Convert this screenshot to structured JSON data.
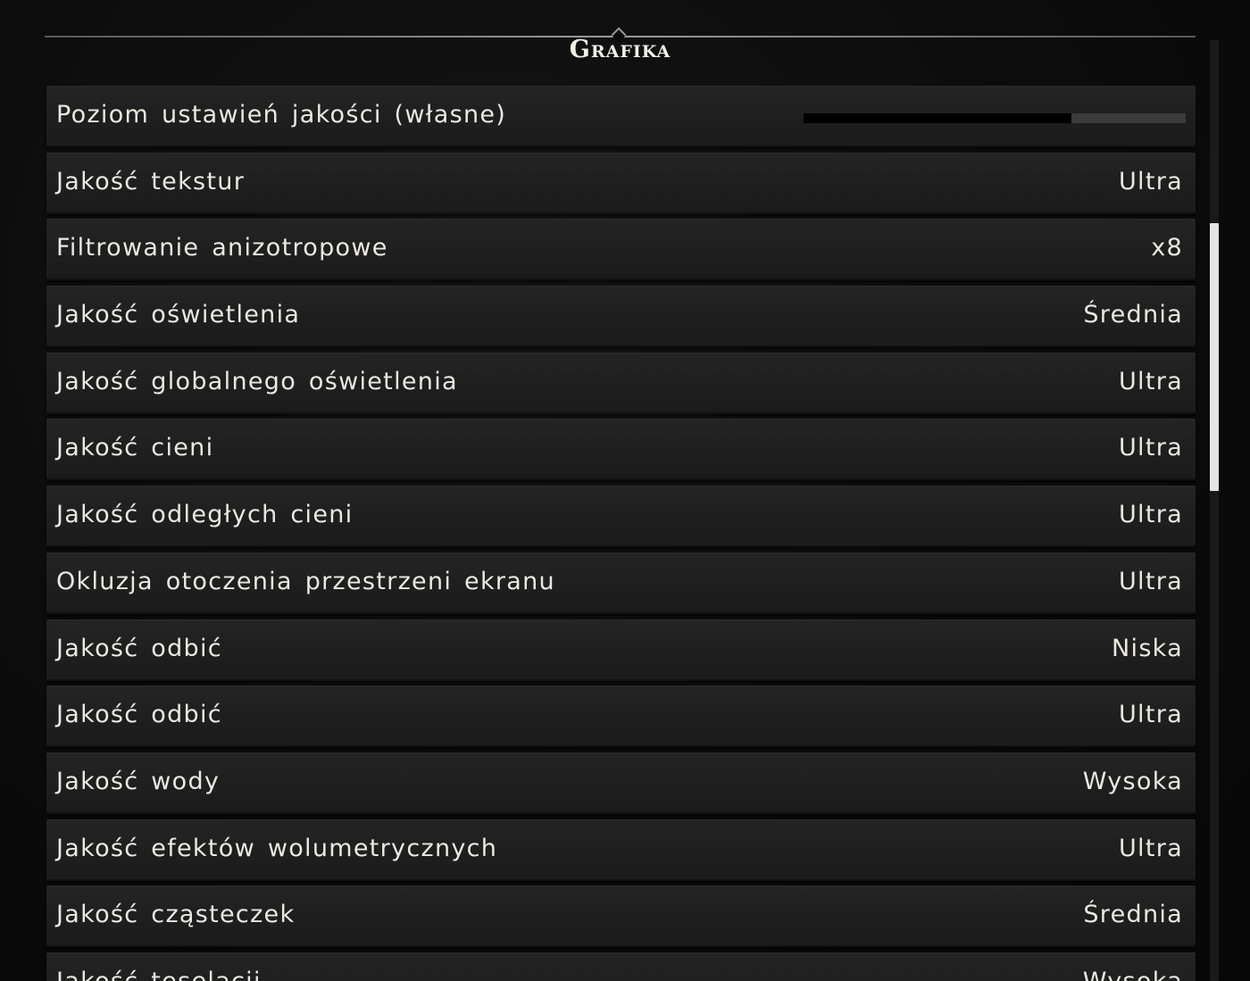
{
  "header": {
    "title": "Grafika"
  },
  "preset": {
    "label": "Poziom ustawień jakości (własne)",
    "level": 0.7
  },
  "settings": [
    {
      "label": "Jakość tekstur",
      "value": "Ultra"
    },
    {
      "label": "Filtrowanie anizotropowe",
      "value": "x8"
    },
    {
      "label": "Jakość oświetlenia",
      "value": "Średnia"
    },
    {
      "label": "Jakość globalnego oświetlenia",
      "value": "Ultra"
    },
    {
      "label": "Jakość cieni",
      "value": "Ultra"
    },
    {
      "label": "Jakość odległych cieni",
      "value": "Ultra"
    },
    {
      "label": "Okluzja otoczenia przestrzeni ekranu",
      "value": "Ultra"
    },
    {
      "label": "Jakość odbić",
      "value": "Niska"
    },
    {
      "label": "Jakość odbić",
      "value": "Ultra"
    },
    {
      "label": "Jakość wody",
      "value": "Wysoka"
    },
    {
      "label": "Jakość efektów wolumetrycznych",
      "value": "Ultra"
    },
    {
      "label": "Jakość cząsteczek",
      "value": "Średnia"
    },
    {
      "label": "Jakość teselacji",
      "value": "Wysoka"
    }
  ],
  "scrollbar": {
    "position": 0.2
  },
  "colors": {
    "background": "#0b0b0b",
    "row": "#212121",
    "text": "#ebe8e1",
    "scrollbar_thumb": "#e4e4e4"
  }
}
